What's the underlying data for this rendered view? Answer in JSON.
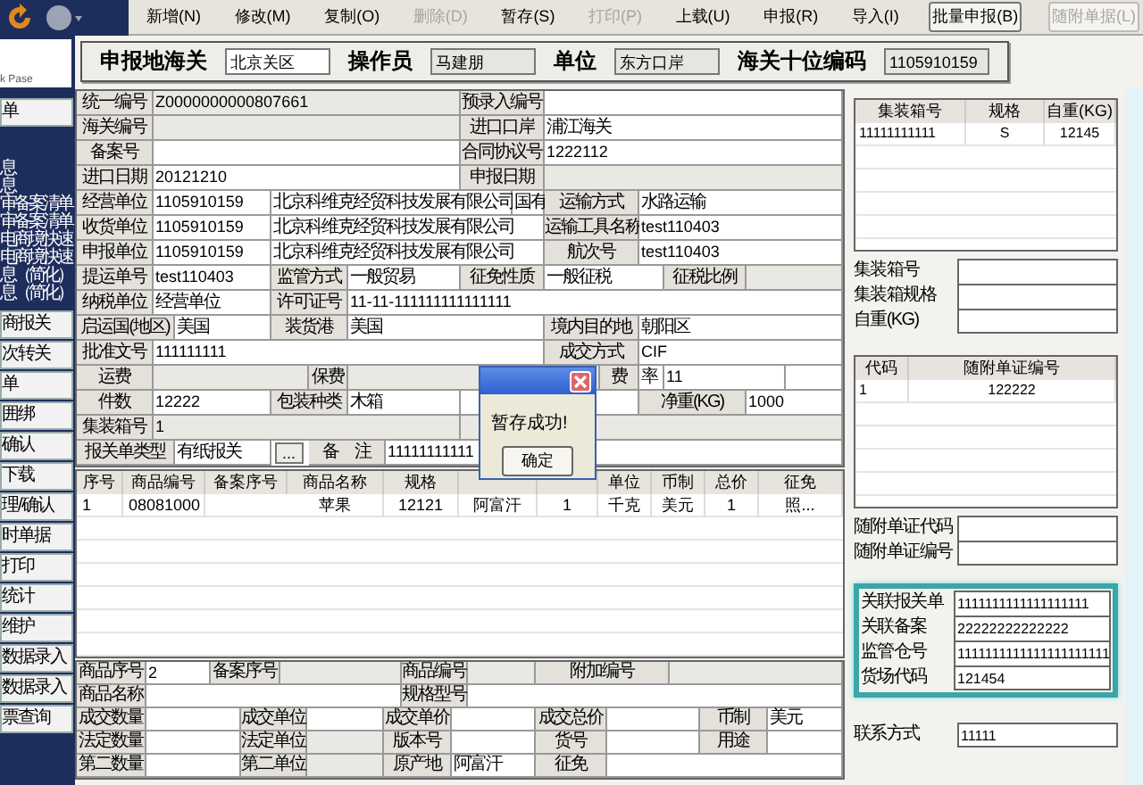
{
  "toolbar": {
    "buttons": [
      {
        "label": "新增(N)",
        "kind": "plain",
        "disabled": false
      },
      {
        "label": "修改(M)",
        "kind": "plain",
        "disabled": false
      },
      {
        "label": "复制(O)",
        "kind": "plain",
        "disabled": false
      },
      {
        "label": "删除(D)",
        "kind": "plain",
        "disabled": true
      },
      {
        "label": "暂存(S)",
        "kind": "plain",
        "disabled": false
      },
      {
        "label": "打印(P)",
        "kind": "plain",
        "disabled": true
      },
      {
        "label": "上载(U)",
        "kind": "plain",
        "disabled": false
      },
      {
        "label": "申报(R)",
        "kind": "plain",
        "disabled": false
      },
      {
        "label": "导入(I)",
        "kind": "plain",
        "disabled": false
      },
      {
        "label": "批量申报(B)",
        "kind": "framed",
        "disabled": false
      },
      {
        "label": "随附单据(L)",
        "kind": "framed",
        "disabled": true
      }
    ]
  },
  "sidebar": {
    "logo_text": "k Pase",
    "top_button": "单",
    "menu_lines": [
      "息",
      "息",
      "审备案清单",
      "审备案清单",
      "电商境快速",
      "电商境快速",
      "息（简化）",
      "息（简化）"
    ],
    "buttons": [
      "商报关",
      "次转关",
      "单",
      "囲绑",
      "确认",
      "下载",
      "理/确认",
      "时单据",
      "打印",
      "统计",
      "维护",
      "数据录入",
      "数据录入",
      "票查询"
    ]
  },
  "header": {
    "fields": [
      {
        "label": "申报地海关",
        "value": "北京关区",
        "readonly": false
      },
      {
        "label": "操作员",
        "value": "马建朋",
        "readonly": true
      },
      {
        "label": "单位",
        "value": "东方口岸",
        "readonly": true
      },
      {
        "label": "海关十位编码",
        "value": "1105910159",
        "readonly": true
      }
    ]
  },
  "declaration_form": {
    "rows": [
      {
        "fields": [
          {
            "label": "统一编号",
            "values": [
              {
                "text": "Z0000000000807661",
                "readonly": true
              }
            ]
          },
          {
            "label": "预录入编号",
            "values": [
              {
                "readonly": false
              }
            ]
          }
        ]
      },
      {
        "fields": [
          {
            "label": "海关编号",
            "values": [
              {
                "readonly": true
              }
            ]
          },
          {
            "label": "进口口岸",
            "values": [
              {
                "text": "浦江海关",
                "readonly": false
              }
            ]
          }
        ]
      },
      {
        "fields": [
          {
            "label": "备案号",
            "values": [
              {
                "readonly": false
              }
            ]
          },
          {
            "label": "合同协议号",
            "values": [
              {
                "text": "1222112",
                "readonly": false
              }
            ]
          }
        ]
      },
      {
        "fields": [
          {
            "label": "进口日期",
            "values": [
              {
                "text": "20121210",
                "readonly": false
              }
            ]
          },
          {
            "label": "申报日期",
            "values": [
              {
                "readonly": true
              }
            ]
          }
        ]
      },
      {
        "fields": [
          {
            "label": "经营单位",
            "values": [
              {
                "text": "1105910159",
                "readonly": false
              },
              {
                "text": "北京科维克经贸科技发展有限公司",
                "readonly": false
              },
              {
                "text": "国有",
                "readonly": false
              }
            ]
          },
          {
            "label": "运输方式",
            "values": [
              {
                "text": "水路运输",
                "readonly": false
              }
            ]
          }
        ]
      },
      {
        "fields": [
          {
            "label": "收货单位",
            "values": [
              {
                "text": "1105910159",
                "readonly": false
              },
              {
                "text": "北京科维克经贸科技发展有限公司",
                "readonly": false
              }
            ]
          },
          {
            "label": "运输工具名称",
            "values": [
              {
                "text": "test110403",
                "readonly": false
              }
            ]
          }
        ]
      },
      {
        "fields": [
          {
            "label": "申报单位",
            "values": [
              {
                "text": "1105910159",
                "readonly": false
              },
              {
                "text": "北京科维克经贸科技发展有限公司",
                "readonly": false
              }
            ]
          },
          {
            "label": "航次号",
            "values": [
              {
                "text": "test110403",
                "readonly": false
              }
            ]
          }
        ]
      },
      {
        "fields": [
          {
            "label": "提运单号",
            "values": [
              {
                "text": "test110403",
                "readonly": false
              }
            ]
          },
          {
            "label": "监管方式",
            "values": [
              {
                "text": "一般贸易",
                "readonly": false
              }
            ]
          },
          {
            "label": "征免性质",
            "values": [
              {
                "text": "一般征税",
                "readonly": false
              }
            ]
          },
          {
            "label": "征税比例",
            "values": [
              {
                "readonly": true
              }
            ]
          }
        ]
      },
      {
        "fields": [
          {
            "label": "纳税单位",
            "values": [
              {
                "text": "经营单位",
                "readonly": false
              }
            ]
          },
          {
            "label": "许可证号",
            "values": [
              {
                "text": "11-11-111111111111111",
                "readonly": false
              }
            ]
          }
        ]
      },
      {
        "fields": [
          {
            "label": "启运国(地区)",
            "values": [
              {
                "text": "美国",
                "readonly": false
              }
            ]
          },
          {
            "label": "装货港",
            "values": [
              {
                "text": "美国",
                "readonly": false
              }
            ]
          },
          {
            "label": "境内目的地",
            "values": [
              {
                "text": "朝阳区",
                "readonly": false
              }
            ]
          }
        ]
      },
      {
        "fields": [
          {
            "label": "批准文号",
            "values": [
              {
                "text": "111111111",
                "readonly": false
              }
            ]
          },
          {
            "label": "成交方式",
            "values": [
              {
                "text": "CIF",
                "readonly": false
              }
            ]
          }
        ]
      },
      {
        "fields": [
          {
            "label": "运费",
            "values": [
              {
                "readonly": true
              }
            ]
          },
          {
            "label": "保费",
            "values": [
              {
                "readonly": true
              }
            ]
          },
          {
            "label": "费",
            "values": [
              {
                "text": "率",
                "readonly": false
              },
              {
                "text": "11",
                "readonly": false
              },
              {
                "readonly": false
              }
            ]
          }
        ]
      },
      {
        "fields": [
          {
            "label": "件数",
            "values": [
              {
                "text": "12222",
                "readonly": false
              }
            ]
          },
          {
            "label": "包装种类",
            "values": [
              {
                "text": "木箱",
                "readonly": false
              },
              {
                "readonly": false
              }
            ]
          },
          {
            "label": "净重(KG)",
            "values": [
              {
                "text": "1000",
                "readonly": false
              }
            ]
          }
        ]
      },
      {
        "fields": [
          {
            "label": "集装箱号",
            "values": [
              {
                "text": "1",
                "readonly": true
              },
              {
                "readonly": true
              }
            ]
          }
        ]
      },
      {
        "fields": [
          {
            "label": "报关单类型",
            "values": [
              {
                "text": "有纸报关",
                "readonly": false
              }
            ],
            "button": "..."
          },
          {
            "label": "备　注",
            "values": [
              {
                "text": "11111111111",
                "readonly": false
              }
            ]
          }
        ]
      }
    ]
  },
  "goods_table": {
    "columns": [
      {
        "label": "序号"
      },
      {
        "label": "商品编号"
      },
      {
        "label": "备案序号"
      },
      {
        "label": "商品名称"
      },
      {
        "label": "规格"
      },
      {},
      {},
      {
        "label": "单位"
      },
      {
        "label": "币制"
      },
      {
        "label": "总价"
      },
      {
        "label": "征免"
      }
    ],
    "rows": [
      [
        {
          "text": "1"
        },
        {
          "text": "08081000"
        },
        {},
        {
          "text": "苹果"
        },
        {
          "text": "12121"
        },
        {
          "text": "阿富汗"
        },
        {
          "text": "1"
        },
        {
          "text": "千克"
        },
        {
          "text": "美元"
        },
        {
          "text": "1"
        },
        {
          "text": "照..."
        }
      ]
    ]
  },
  "goods_detail": {
    "rows": [
      {
        "fields": [
          {
            "label": "商品序号",
            "values": [
              {
                "text": "2",
                "readonly": false
              }
            ]
          },
          {
            "label": "备案序号",
            "values": [
              {
                "readonly": true
              }
            ]
          },
          {
            "label": "商品编号",
            "values": [
              {
                "readonly": true
              }
            ]
          },
          {
            "label": "附加编号",
            "values": [
              {
                "readonly": true
              }
            ]
          }
        ]
      },
      {
        "fields": [
          {
            "label": "商品名称",
            "values": [
              {
                "readonly": false
              }
            ]
          },
          {
            "label": "规格型号",
            "values": [
              {
                "readonly": false
              }
            ]
          }
        ]
      },
      {
        "fields": [
          {
            "label": "成交数量",
            "values": [
              {
                "readonly": false
              }
            ]
          },
          {
            "label": "成交单位",
            "values": [
              {
                "readonly": false
              }
            ]
          },
          {
            "label": "成交单价",
            "values": [
              {
                "readonly": false
              }
            ]
          },
          {
            "label": "成交总价",
            "values": [
              {
                "readonly": false
              }
            ]
          },
          {
            "label": "币制",
            "values": [
              {
                "text": "美元",
                "readonly": false
              }
            ]
          }
        ]
      },
      {
        "fields": [
          {
            "label": "法定数量",
            "values": [
              {
                "readonly": false
              }
            ]
          },
          {
            "label": "法定单位",
            "values": [
              {
                "readonly": true
              }
            ]
          },
          {
            "label": "版本号",
            "values": [
              {
                "readonly": false
              }
            ]
          },
          {
            "label": "货号",
            "values": [
              {
                "readonly": false
              }
            ]
          },
          {
            "label": "用途",
            "values": [
              {
                "readonly": false
              }
            ]
          }
        ]
      },
      {
        "fields": [
          {
            "label": "第二数量",
            "values": [
              {
                "readonly": false
              }
            ]
          },
          {
            "label": "第二单位",
            "values": [
              {
                "readonly": true
              }
            ]
          },
          {
            "label": "原产地",
            "values": [
              {
                "text": "阿富汗",
                "readonly": false
              }
            ]
          },
          {
            "label": "征免",
            "values": [
              {
                "readonly": false
              }
            ]
          }
        ]
      }
    ]
  },
  "side_panel": {
    "container_table": {
      "columns": [
        "集装箱号",
        "规格",
        "自重(KG)"
      ],
      "rows": [
        [
          "11111111111",
          "S",
          "12145"
        ]
      ]
    },
    "container_fields": [
      {
        "label": "集装箱号"
      },
      {
        "label": "集装箱规格"
      },
      {
        "label": "自重(KG)"
      }
    ],
    "document_table": {
      "columns": [
        "代码",
        "随附单证编号"
      ],
      "rows": [
        [
          "1",
          "122222"
        ]
      ]
    },
    "document_fields": [
      {
        "label": "随附单证代码"
      },
      {
        "label": "随附单证编号"
      }
    ],
    "related_fields": [
      {
        "label": "关联报关单",
        "value": "1111111111111111111"
      },
      {
        "label": "关联备案",
        "value": "22222222222222"
      },
      {
        "label": "监管仓号",
        "value": "1111111111111111111111"
      },
      {
        "label": "货场代码",
        "value": "121454"
      }
    ],
    "contact_field": {
      "label": "联系方式",
      "value": "11111"
    }
  },
  "dialog": {
    "message": "暂存成功!",
    "button": "确定"
  }
}
